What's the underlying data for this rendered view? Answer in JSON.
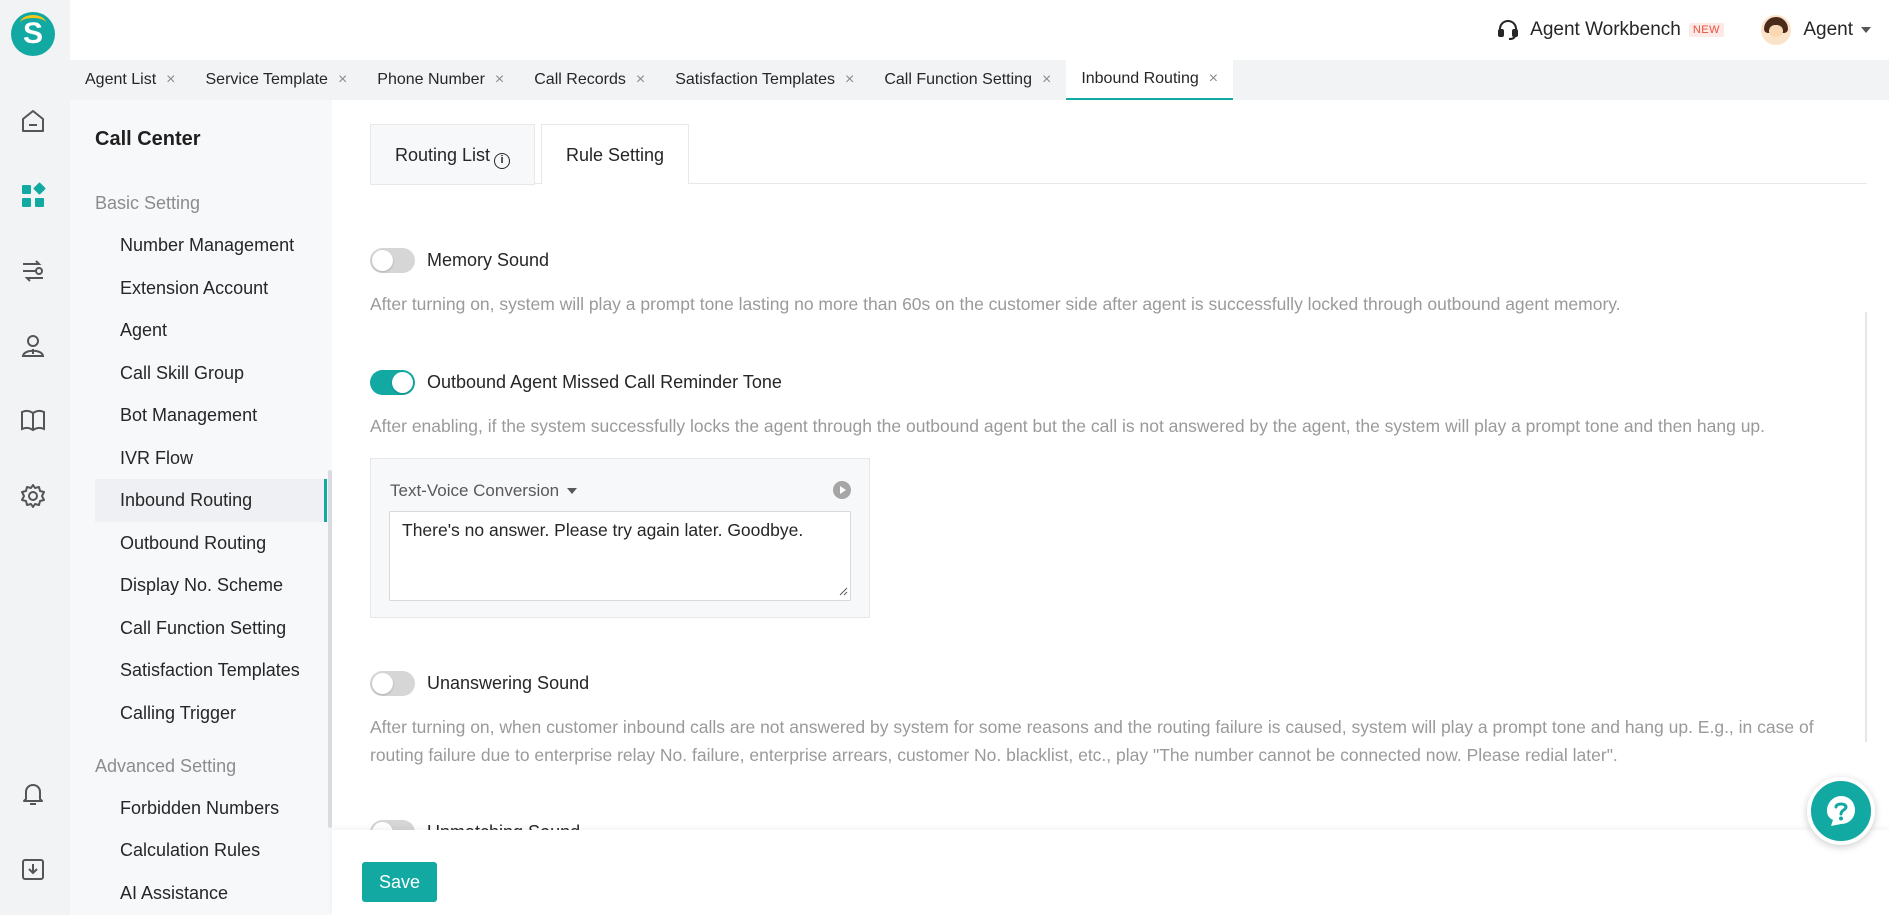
{
  "header": {
    "workbench_label": "Agent Workbench",
    "new_badge": "NEW",
    "user_name": "Agent"
  },
  "tabs": [
    {
      "label": "Agent List"
    },
    {
      "label": "Service Template"
    },
    {
      "label": "Phone Number"
    },
    {
      "label": "Call Records"
    },
    {
      "label": "Satisfaction Templates"
    },
    {
      "label": "Call Function Setting"
    },
    {
      "label": "Inbound Routing"
    }
  ],
  "subnav": {
    "title": "Call Center",
    "groups": [
      {
        "title": "Basic Setting",
        "items": [
          {
            "label": "Number Management"
          },
          {
            "label": "Extension Account"
          },
          {
            "label": "Agent"
          },
          {
            "label": "Call Skill Group"
          },
          {
            "label": "Bot Management"
          },
          {
            "label": "IVR Flow"
          },
          {
            "label": "Inbound Routing"
          },
          {
            "label": "Outbound Routing"
          },
          {
            "label": "Display No. Scheme"
          },
          {
            "label": "Call Function Setting"
          },
          {
            "label": "Satisfaction Templates"
          },
          {
            "label": "Calling Trigger"
          }
        ]
      },
      {
        "title": "Advanced Setting",
        "items": [
          {
            "label": "Forbidden Numbers"
          },
          {
            "label": "Calculation Rules"
          },
          {
            "label": "AI Assistance"
          }
        ]
      }
    ]
  },
  "content_tabs": {
    "routing_list": "Routing List",
    "rule_setting": "Rule Setting"
  },
  "settings": {
    "memory_sound": {
      "label": "Memory Sound",
      "enabled": false,
      "description": "After turning on, system will play a prompt tone lasting no more than 60s on the customer side after agent is successfully locked through outbound agent memory."
    },
    "missed_call_tone": {
      "label": "Outbound Agent Missed Call Reminder Tone",
      "enabled": true,
      "description": "After enabling, if the system successfully locks the agent through the outbound agent but the call is not answered by the agent, the system will play a prompt tone and then hang up.",
      "voice_mode": "Text-Voice Conversion",
      "voice_text": "There's no answer. Please try again later. Goodbye."
    },
    "unanswering_sound": {
      "label": "Unanswering Sound",
      "enabled": false,
      "description": "After turning on, when customer inbound calls are not answered by system for some reasons and the routing failure is caused, system will play a prompt tone and hang up. E.g., in case of routing failure due to enterprise relay No. failure, enterprise arrears, customer No. blacklist, etc., play \"The number cannot be connected now. Please redial later\"."
    },
    "unmatching_sound": {
      "label": "Unmatching Sound",
      "enabled": false
    }
  },
  "footer": {
    "save_label": "Save"
  },
  "colors": {
    "accent": "#13a9a3",
    "rail_bg": "#f2f3f5"
  }
}
